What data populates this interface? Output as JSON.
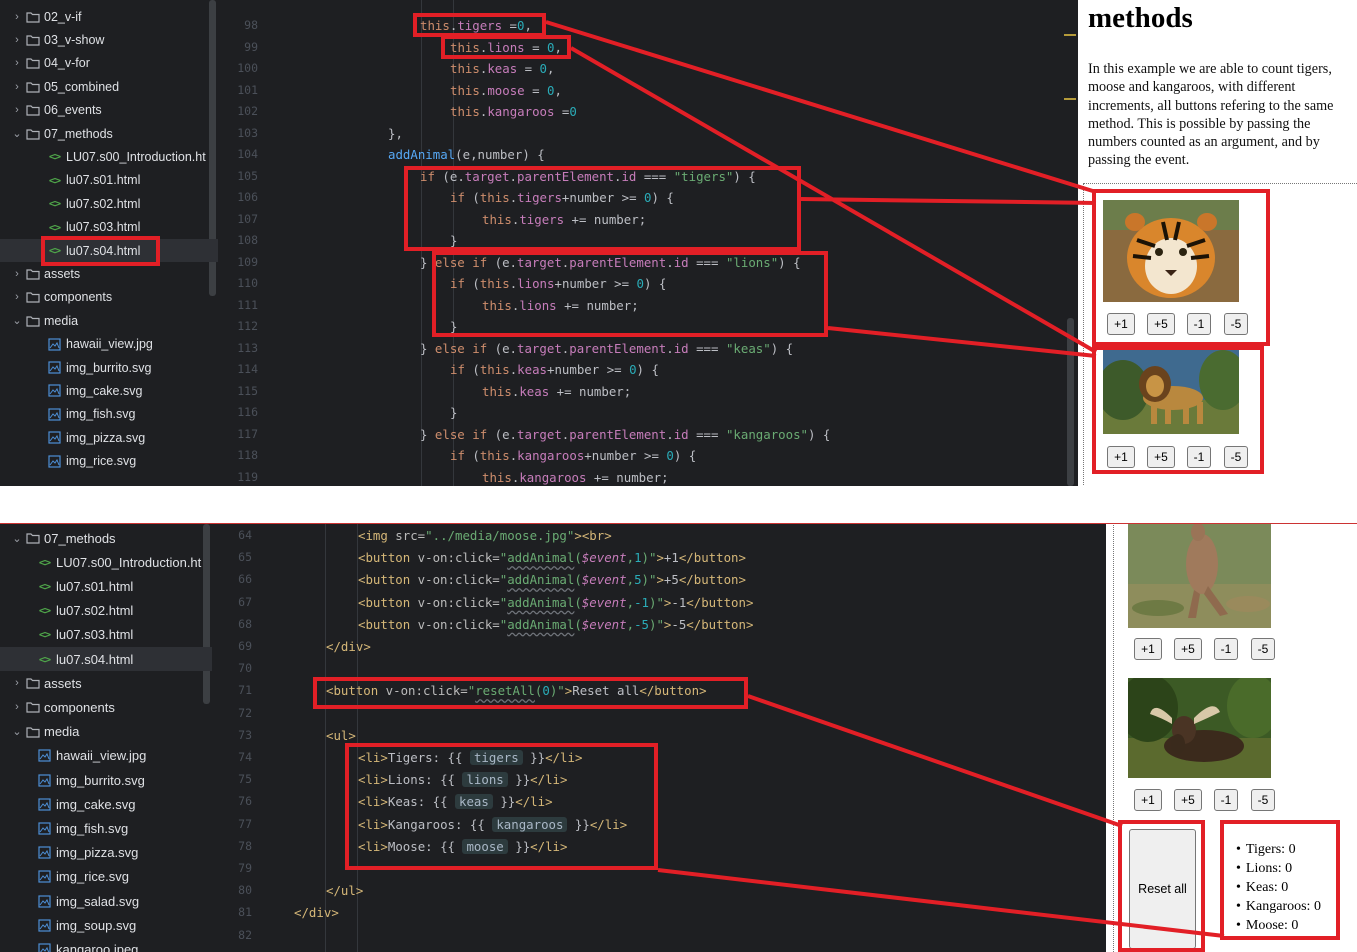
{
  "top": {
    "tree": [
      {
        "label": "02_v-if",
        "type": "folder",
        "state": "collapsed"
      },
      {
        "label": "03_v-show",
        "type": "folder",
        "state": "collapsed"
      },
      {
        "label": "04_v-for",
        "type": "folder",
        "state": "collapsed"
      },
      {
        "label": "05_combined",
        "type": "folder",
        "state": "collapsed"
      },
      {
        "label": "06_events",
        "type": "folder",
        "state": "collapsed"
      },
      {
        "label": "07_methods",
        "type": "folder",
        "state": "expanded"
      },
      {
        "label": "LU07.s00_Introduction.ht",
        "type": "html"
      },
      {
        "label": "lu07.s01.html",
        "type": "html"
      },
      {
        "label": "lu07.s02.html",
        "type": "html"
      },
      {
        "label": "lu07.s03.html",
        "type": "html"
      },
      {
        "label": "lu07.s04.html",
        "type": "html",
        "selected": true
      },
      {
        "label": "assets",
        "type": "folder",
        "state": "collapsed"
      },
      {
        "label": "components",
        "type": "folder",
        "state": "collapsed"
      },
      {
        "label": "media",
        "type": "folder",
        "state": "expanded"
      },
      {
        "label": "hawaii_view.jpg",
        "type": "image"
      },
      {
        "label": "img_burrito.svg",
        "type": "image"
      },
      {
        "label": "img_cake.svg",
        "type": "image"
      },
      {
        "label": "img_fish.svg",
        "type": "image"
      },
      {
        "label": "img_pizza.svg",
        "type": "image"
      },
      {
        "label": "img_rice.svg",
        "type": "image"
      }
    ],
    "line_numbers": [
      "98",
      "99",
      "100",
      "101",
      "102",
      "103",
      "104",
      "105",
      "106",
      "107",
      "108",
      "109",
      "110",
      "111",
      "112",
      "113",
      "114",
      "115",
      "116",
      "117",
      "118",
      "119"
    ],
    "code_lines": [
      "this.tigers =0,",
      "this.lions = 0,",
      "this.keas = 0,",
      "this.moose = 0,",
      "this.kangaroos =0",
      "},",
      "addAnimal(e,number) {",
      "if (e.target.parentElement.id === \"tigers\") {",
      "if (this.tigers+number >= 0) {",
      "this.tigers += number;",
      "}",
      "} else if (e.target.parentElement.id === \"lions\") {",
      "if (this.lions+number >= 0) {",
      "this.lions += number;",
      "}",
      "} else if (e.target.parentElement.id === \"keas\") {",
      "if (this.keas+number >= 0) {",
      "this.keas += number;",
      "}",
      "} else if (e.target.parentElement.id === \"kangaroos\") {",
      "if (this.kangaroos+number >= 0) {",
      "this.kangaroos += number;"
    ],
    "preview": {
      "title": "methods",
      "description": "In this example we are able to count tigers, moose and kangaroos, with different increments, all buttons refering to the same method. This is possible by passing the numbers counted as an argument, and by passing the event.",
      "buttons": [
        "+1",
        "+5",
        "-1",
        "-5"
      ],
      "animals": [
        "tiger",
        "lion"
      ]
    }
  },
  "bottom": {
    "tree": [
      {
        "label": "07_methods",
        "type": "folder",
        "state": "expanded"
      },
      {
        "label": "LU07.s00_Introduction.ht",
        "type": "html"
      },
      {
        "label": "lu07.s01.html",
        "type": "html"
      },
      {
        "label": "lu07.s02.html",
        "type": "html"
      },
      {
        "label": "lu07.s03.html",
        "type": "html"
      },
      {
        "label": "lu07.s04.html",
        "type": "html",
        "selected": true
      },
      {
        "label": "assets",
        "type": "folder",
        "state": "collapsed"
      },
      {
        "label": "components",
        "type": "folder",
        "state": "collapsed"
      },
      {
        "label": "media",
        "type": "folder",
        "state": "expanded"
      },
      {
        "label": "hawaii_view.jpg",
        "type": "image"
      },
      {
        "label": "img_burrito.svg",
        "type": "image"
      },
      {
        "label": "img_cake.svg",
        "type": "image"
      },
      {
        "label": "img_fish.svg",
        "type": "image"
      },
      {
        "label": "img_pizza.svg",
        "type": "image"
      },
      {
        "label": "img_rice.svg",
        "type": "image"
      },
      {
        "label": "img_salad.svg",
        "type": "image"
      },
      {
        "label": "img_soup.svg",
        "type": "image"
      },
      {
        "label": "kangaroo.jpeg",
        "type": "image"
      }
    ],
    "line_numbers": [
      "64",
      "65",
      "66",
      "67",
      "68",
      "69",
      "70",
      "71",
      "72",
      "73",
      "74",
      "75",
      "76",
      "77",
      "78",
      "79",
      "80",
      "81",
      "82"
    ],
    "code_lines": [
      "<img src=\"../media/moose.jpg\"><br>",
      "<button v-on:click=\"addAnimal($event,1)\">+1</button>",
      "<button v-on:click=\"addAnimal($event,5)\">+5</button>",
      "<button v-on:click=\"addAnimal($event,-1)\">-1</button>",
      "<button v-on:click=\"addAnimal($event,-5)\">-5</button>",
      "</div>",
      "",
      "<button v-on:click=\"resetAll(0)\">Reset all</button>",
      "",
      "<ul>",
      "<li>Tigers: {{ tigers }}</li>",
      "<li>Lions: {{ lions }}</li>",
      "<li>Keas: {{ keas }}</li>",
      "<li>Kangaroos: {{ kangaroos }}</li>",
      "<li>Moose: {{ moose }}</li>",
      "",
      "</ul>",
      "</div>",
      ""
    ],
    "preview": {
      "buttons": [
        "+1",
        "+5",
        "-1",
        "-5"
      ],
      "animals": [
        "kangaroo",
        "moose"
      ],
      "reset_label": "Reset all",
      "tally": [
        "Tigers: 0",
        "Lions: 0",
        "Keas: 0",
        "Kangaroos: 0",
        "Moose: 0"
      ]
    }
  },
  "colors": {
    "annotation": "#e21f26",
    "editor_bg": "#1e1f22",
    "keyword": "#cf8e6d",
    "property": "#c77dbb",
    "number": "#2aacb8",
    "string": "#6aab73",
    "function": "#56a8f5",
    "tag": "#d5b778"
  },
  "icons": {
    "folder": "folder-icon",
    "html": "html-file-icon",
    "image": "image-file-icon",
    "chevron_collapsed": "chevron-right-icon",
    "chevron_expanded": "chevron-down-icon"
  }
}
